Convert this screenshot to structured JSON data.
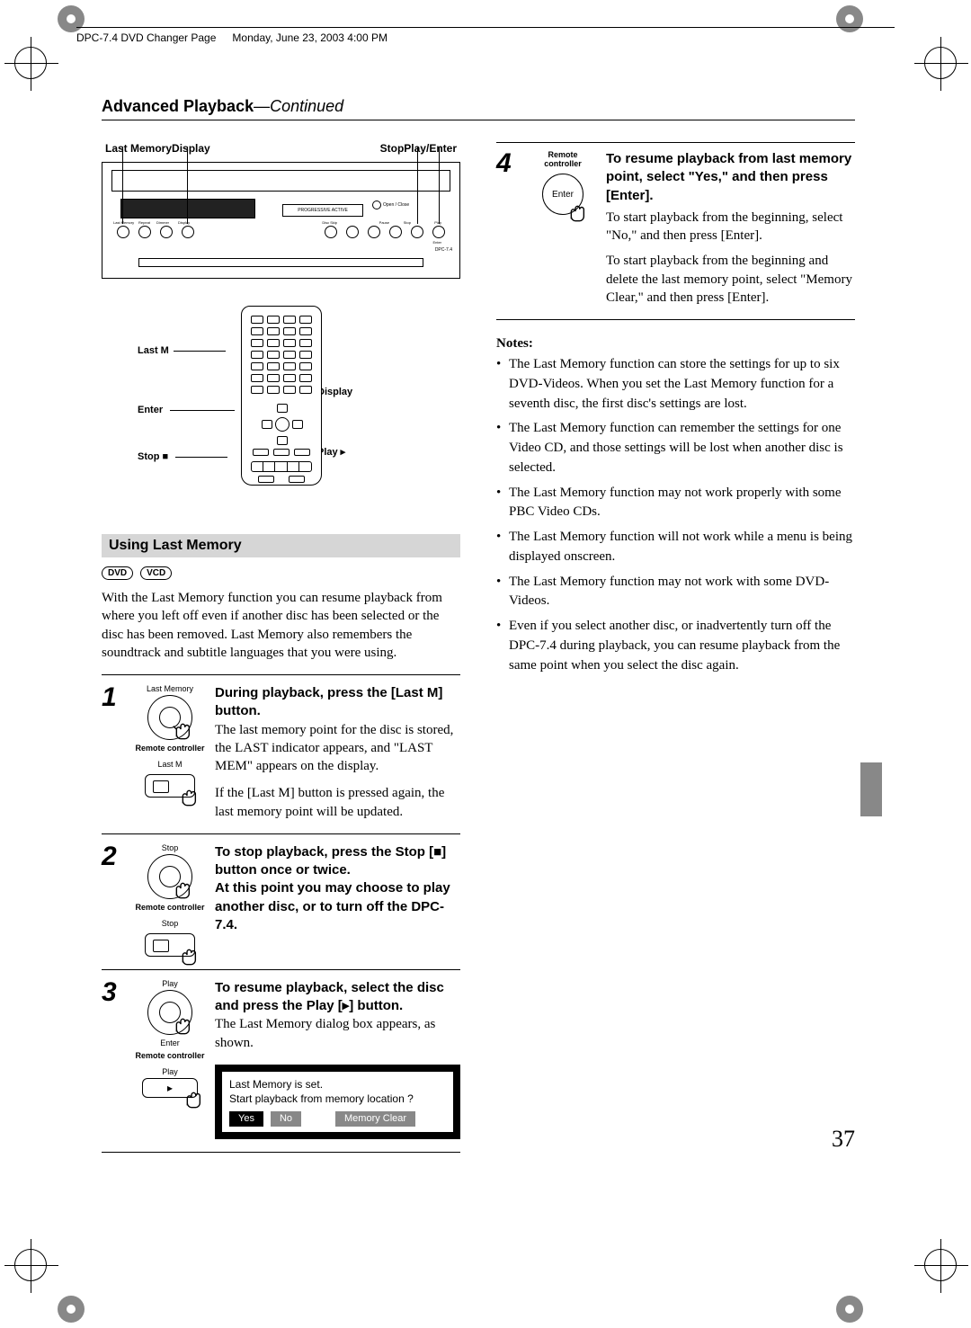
{
  "header_meta": {
    "file": "DPC-7.4 DVD Changer  Page",
    "date": "Monday, June 23, 2003  4:00 PM"
  },
  "section_title_bold": "Advanced Playback",
  "section_title_sep": "—",
  "section_title_ital": "Continued",
  "panel_labels": {
    "last_memory": "Last Memory",
    "display": "Display",
    "stop": "Stop",
    "play_enter": "Play/Enter"
  },
  "player": {
    "progressive": "PROGRESSIVE ACTIVE",
    "open_close": "Open / Close",
    "model": "DPC-7.4",
    "lbl_lastmem": "Last Memory",
    "lbl_repeat": "Repeat",
    "lbl_dimmer": "Dimmer",
    "lbl_display": "Display",
    "lbl_discskip": "Disc Skip",
    "lbl_prev": "",
    "lbl_next": "",
    "lbl_pause": "Pause",
    "lbl_stop2": "Stop",
    "lbl_play2": "Play",
    "lbl_enter2": "Enter"
  },
  "remote_labels": {
    "last_m": "Last M",
    "enter": "Enter",
    "stop": "Stop ■",
    "display": "Display",
    "play": "Play ▸"
  },
  "band_title": "Using Last Memory",
  "badges": {
    "dvd": "DVD",
    "vcd": "VCD"
  },
  "intro": "With the Last Memory function you can resume playback from where you left off even if another disc has been selected or the disc has been removed. Last Memory also remembers the soundtrack and subtitle languages that you were using.",
  "steps": {
    "s1": {
      "num": "1",
      "knob_lbl": "Last Memory",
      "rc": "Remote controller",
      "panel_lbl": "Last M",
      "head": "During playback, press the [Last M] button.",
      "p1": "The last memory point for the disc is stored, the LAST indicator appears, and \"LAST MEM\" appears on the display.",
      "p2": "If the [Last M] button is pressed again, the last memory point will be updated."
    },
    "s2": {
      "num": "2",
      "knob_lbl": "Stop",
      "rc": "Remote controller",
      "panel_lbl": "Stop",
      "head": "To stop playback, press the Stop [■] button once or twice.",
      "head2": "At this point you may choose to play another disc, or to turn off the DPC-7.4."
    },
    "s3": {
      "num": "3",
      "knob_lbl": "Play",
      "knob_lbl2": "Enter",
      "rc": "Remote controller",
      "panel_lbl": "Play",
      "head": "To resume playback, select the disc and press the Play [▸] button.",
      "p1": "The Last Memory dialog box appears, as shown.",
      "osd_l1": "Last Memory is set.",
      "osd_l2": "Start playback from memory location ?",
      "osd_yes": "Yes",
      "osd_no": "No",
      "osd_mc": "Memory Clear"
    },
    "s4": {
      "num": "4",
      "rc": "Remote controller",
      "btn": "Enter",
      "head": "To resume playback from last memory point, select \"Yes,\" and then press [Enter].",
      "p1": "To start playback from the beginning, select \"No,\" and then press [Enter].",
      "p2": "To start playback from the beginning and delete the last memory point, select \"Memory Clear,\" and then press [Enter]."
    }
  },
  "notes_h": "Notes:",
  "notes": [
    "The Last Memory function can store the settings for up to six DVD-Videos. When you set the Last Memory function for a seventh disc, the first disc's settings are lost.",
    "The Last Memory function can remember the settings for one Video CD, and those settings will be lost when another disc is selected.",
    "The Last Memory function may not work properly with some PBC Video CDs.",
    "The Last Memory function will not work while a menu is being displayed onscreen.",
    "The Last Memory function may not work with some DVD-Videos.",
    "Even if you select another disc, or inadvertently turn off the DPC-7.4 during playback, you can resume playback from the same point when you select the disc again."
  ],
  "page_number": "37"
}
